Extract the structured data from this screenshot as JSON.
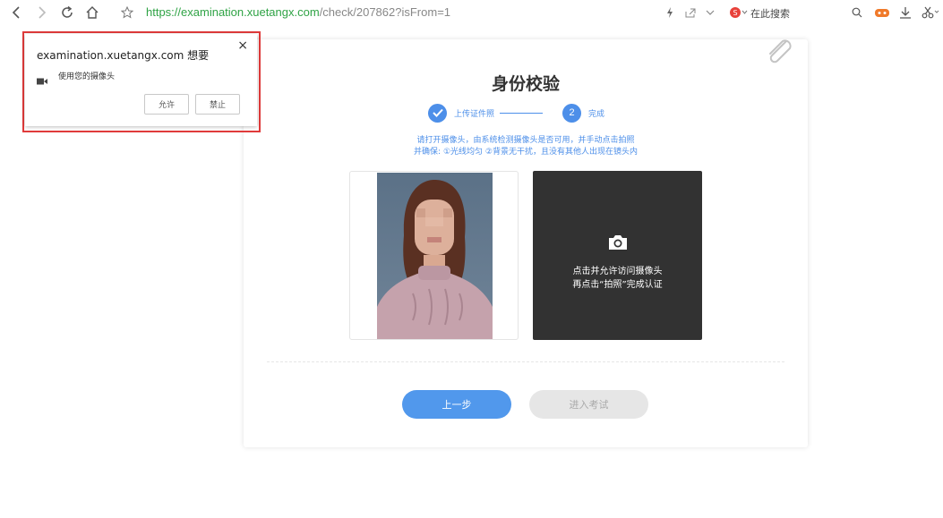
{
  "browser": {
    "url_scheme": "https://",
    "url_host": "examination.xuetangx.com",
    "url_path": "/check/207862?isFrom=1",
    "search_box_text": "在此搜索"
  },
  "permission": {
    "title": "examination.xuetangx.com 想要",
    "close": "×",
    "description": "使用您的摄像头",
    "allow_label": "允许",
    "block_label": "禁止"
  },
  "page": {
    "title": "身份校验",
    "steps": [
      {
        "label": "上传证件照",
        "state": "done"
      },
      {
        "number": "2",
        "label": "完成",
        "state": "active"
      }
    ],
    "instruction_line1": "请打开摄像头，由系统检测摄像头是否可用，并手动点击拍照",
    "instruction_line2": "并确保: ①光线均匀 ②背景无干扰，且没有其他人出现在镜头内",
    "camera_text_line1": "点击并允许访问摄像头",
    "camera_text_line2": "再点击“拍照”完成认证",
    "prev_button": "上一步",
    "enter_button": "进入考试"
  },
  "colors": {
    "accent": "#4d8fe9",
    "highlight": "#e03b3b",
    "camera_bg": "#323232"
  }
}
